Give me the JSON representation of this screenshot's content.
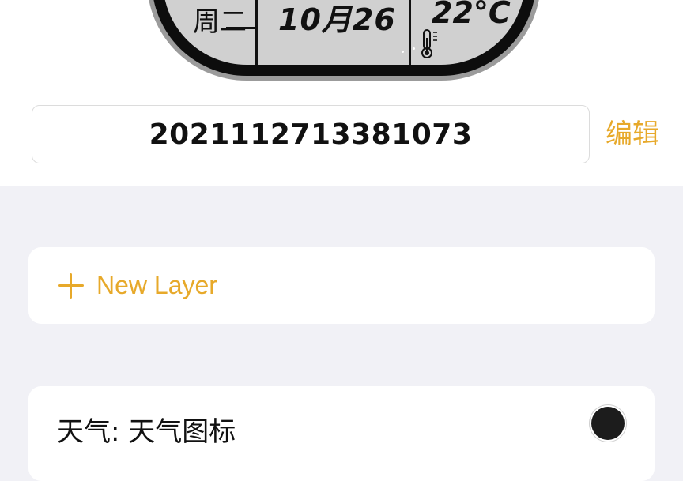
{
  "device_preview": {
    "weekday": "周二",
    "date": "10月26",
    "temperature": "22°C",
    "icon": "thermometer-icon"
  },
  "device_id": {
    "value": "2021112713381073"
  },
  "actions": {
    "edit_label": "编辑"
  },
  "new_layer": {
    "label": "New Layer",
    "icon": "plus-icon"
  },
  "layers": [
    {
      "name": "天气: 天气图标",
      "color": "#1c1c1c"
    }
  ],
  "colors": {
    "accent": "#e7a92a",
    "background": "#f1f1f6",
    "lcd_screen": "#d0d0d0"
  }
}
